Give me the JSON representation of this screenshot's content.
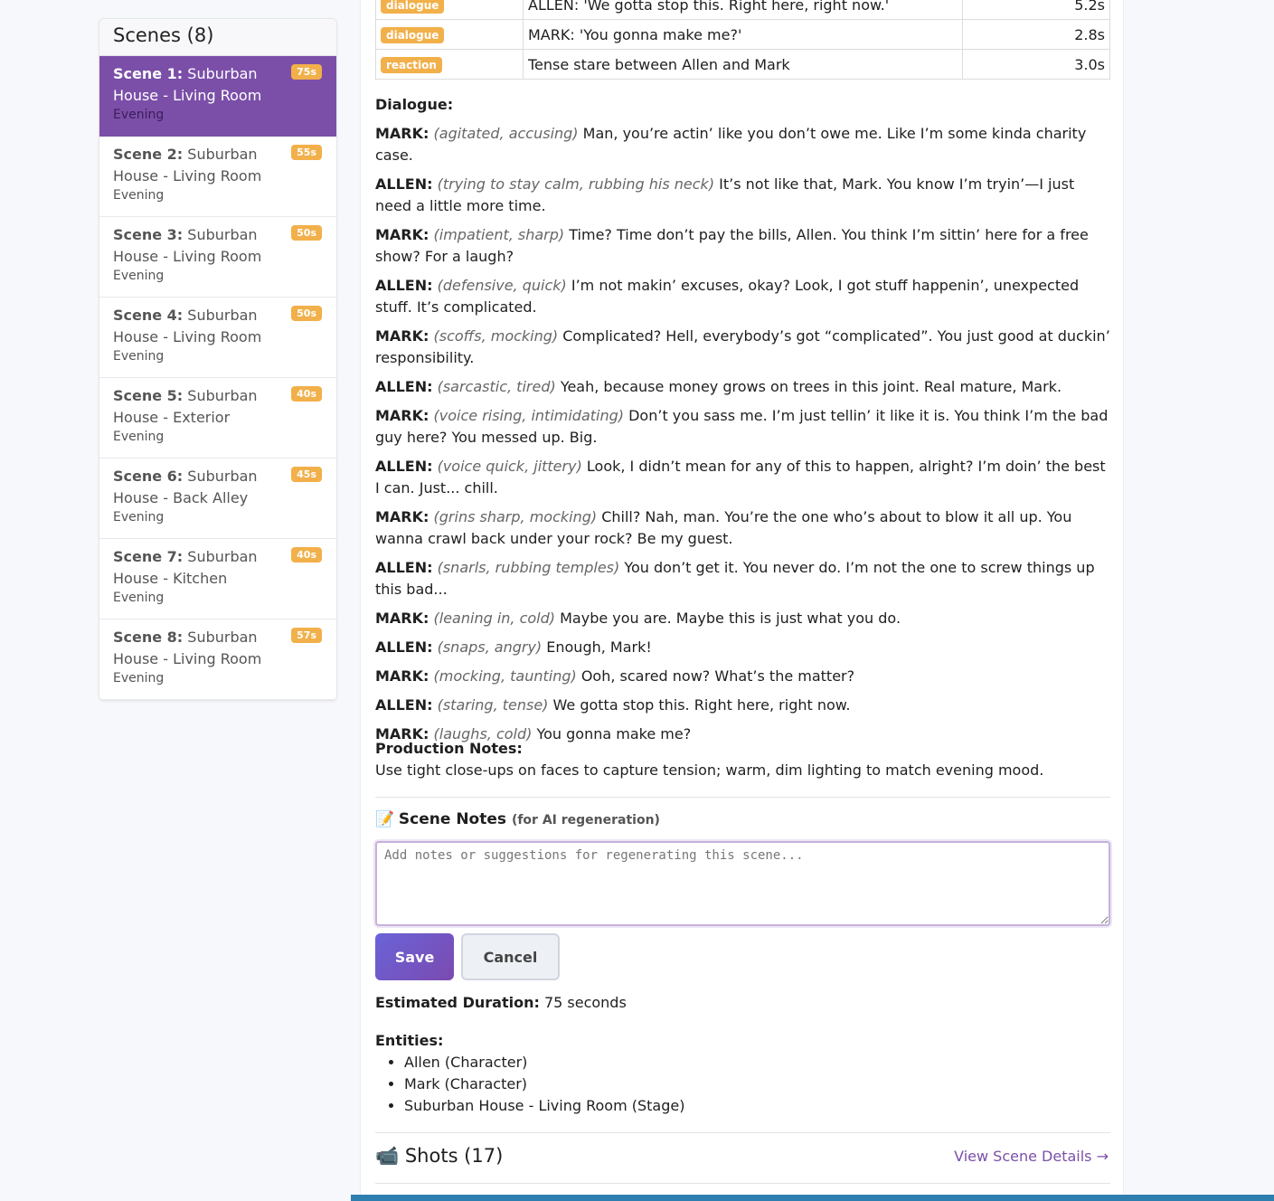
{
  "sidebar": {
    "title": "Scenes (8)",
    "scenes": [
      {
        "num": "Scene 1:",
        "name": "Suburban House - Living Room",
        "time": "Evening",
        "duration": "75s",
        "active": true
      },
      {
        "num": "Scene 2:",
        "name": "Suburban House - Living Room",
        "time": "Evening",
        "duration": "55s"
      },
      {
        "num": "Scene 3:",
        "name": "Suburban House - Living Room",
        "time": "Evening",
        "duration": "50s"
      },
      {
        "num": "Scene 4:",
        "name": "Suburban House - Living Room",
        "time": "Evening",
        "duration": "50s"
      },
      {
        "num": "Scene 5:",
        "name": "Suburban House - Exterior",
        "time": "Evening",
        "duration": "40s"
      },
      {
        "num": "Scene 6:",
        "name": "Suburban House - Back Alley",
        "time": "Evening",
        "duration": "45s"
      },
      {
        "num": "Scene 7:",
        "name": "Suburban House - Kitchen",
        "time": "Evening",
        "duration": "40s"
      },
      {
        "num": "Scene 8:",
        "name": "Suburban House - Living Room",
        "time": "Evening",
        "duration": "57s"
      }
    ]
  },
  "shot_table": [
    {
      "type": "dialogue",
      "desc": "ALLEN: 'We gotta stop this. Right here, right now.'",
      "dur": "5.2s"
    },
    {
      "type": "dialogue",
      "desc": "MARK: 'You gonna make me?'",
      "dur": "2.8s"
    },
    {
      "type": "reaction",
      "desc": "Tense stare between Allen and Mark",
      "dur": "3.0s"
    }
  ],
  "dialogue": {
    "label": "Dialogue:",
    "lines": [
      {
        "speaker": "MARK:",
        "direction": "(agitated, accusing)",
        "text": "Man, you’re actin’ like you don’t owe me. Like I’m some kinda charity case."
      },
      {
        "speaker": "ALLEN:",
        "direction": "(trying to stay calm, rubbing his neck)",
        "text": "It’s not like that, Mark. You know I’m tryin’—I just need a little more time."
      },
      {
        "speaker": "MARK:",
        "direction": "(impatient, sharp)",
        "text": "Time? Time don’t pay the bills, Allen. You think I’m sittin’ here for a free show? For a laugh?"
      },
      {
        "speaker": "ALLEN:",
        "direction": "(defensive, quick)",
        "text": "I’m not makin’ excuses, okay? Look, I got stuff happenin’, unexpected stuff. It’s complicated."
      },
      {
        "speaker": "MARK:",
        "direction": "(scoffs, mocking)",
        "text": "Complicated? Hell, everybody’s got “complicated”. You just good at duckin’ responsibility."
      },
      {
        "speaker": "ALLEN:",
        "direction": "(sarcastic, tired)",
        "text": "Yeah, because money grows on trees in this joint. Real mature, Mark."
      },
      {
        "speaker": "MARK:",
        "direction": "(voice rising, intimidating)",
        "text": "Don’t you sass me. I’m just tellin’ it like it is. You think I’m the bad guy here? You messed up. Big."
      },
      {
        "speaker": "ALLEN:",
        "direction": "(voice quick, jittery)",
        "text": "Look, I didn’t mean for any of this to happen, alright? I’m doin’ the best I can. Just... chill."
      },
      {
        "speaker": "MARK:",
        "direction": "(grins sharp, mocking)",
        "text": "Chill? Nah, man. You’re the one who’s about to blow it all up. You wanna crawl back under your rock? Be my guest."
      },
      {
        "speaker": "ALLEN:",
        "direction": "(snarls, rubbing temples)",
        "text": "You don’t get it. You never do. I’m not the one to screw things up this bad..."
      },
      {
        "speaker": "MARK:",
        "direction": "(leaning in, cold)",
        "text": "Maybe you are. Maybe this is just what you do."
      },
      {
        "speaker": "ALLEN:",
        "direction": "(snaps, angry)",
        "text": "Enough, Mark!"
      },
      {
        "speaker": "MARK:",
        "direction": "(mocking, taunting)",
        "text": "Ooh, scared now? What’s the matter?"
      },
      {
        "speaker": "ALLEN:",
        "direction": "(staring, tense)",
        "text": "We gotta stop this. Right here, right now."
      },
      {
        "speaker": "MARK:",
        "direction": "(laughs, cold)",
        "text": "You gonna make me?"
      }
    ]
  },
  "production_notes": {
    "label": "Production Notes:",
    "text": "Use tight close-ups on faces to capture tension; warm, dim lighting to match evening mood."
  },
  "scene_notes": {
    "icon": "📝",
    "title": "Scene Notes",
    "hint": "(for AI regeneration)",
    "placeholder": "Add notes or suggestions for regenerating this scene...",
    "save_label": "Save",
    "cancel_label": "Cancel"
  },
  "estimated": {
    "label": "Estimated Duration:",
    "value": "75 seconds"
  },
  "entities": {
    "label": "Entities:",
    "items": [
      "Allen (Character)",
      "Mark (Character)",
      "Suburban House - Living Room (Stage)"
    ]
  },
  "shots_section": {
    "icon": "📹",
    "title": "Shots (17)",
    "link": "View Scene Details →"
  },
  "colors": {
    "accent": "#7b4fa8",
    "badge": "#f2b04a",
    "save": "#6a63d8",
    "bottom_bar": "#2f7eb0"
  }
}
